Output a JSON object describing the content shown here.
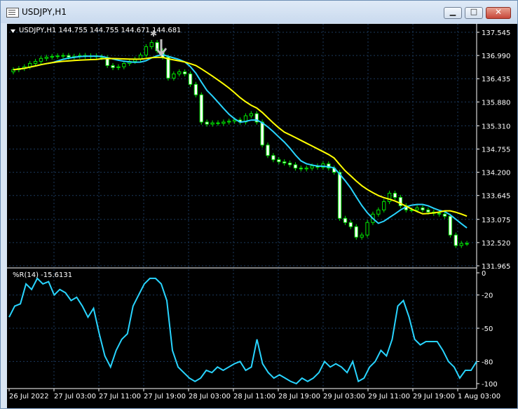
{
  "window": {
    "title": "USDJPY,H1",
    "buttons": {
      "minimize": "▁",
      "maximize": "□",
      "close": "✕"
    }
  },
  "main_panel": {
    "header": "USDJPY,H1  144.755 144.755 144.671 144.681",
    "price_levels": [
      "137.545",
      "136.990",
      "136.435",
      "135.880",
      "135.310",
      "134.755",
      "134.200",
      "133.645",
      "133.075",
      "132.520",
      "131.965"
    ]
  },
  "indicator_panel": {
    "header": "%R(14) -15.6131",
    "levels": [
      "0",
      "-20",
      "-50",
      "-80",
      "-100"
    ]
  },
  "time_labels": [
    "26 Jul 2022",
    "27 Jul 03:00",
    "27 Jul 11:00",
    "27 Jul 19:00",
    "28 Jul 03:00",
    "28 Jul 11:00",
    "28 Jul 19:00",
    "29 Jul 03:00",
    "29 Jul 11:00",
    "29 Jul 19:00",
    "1 Aug 03:00"
  ],
  "colors": {
    "background": "#000000",
    "grid": "#1c3a5e",
    "candle": "#00e600",
    "ma_fast": "#28d4ff",
    "ma_slow": "#ffff00",
    "williams_r": "#28d4ff",
    "text": "#ffffff",
    "arrow": "#c0c0c0"
  },
  "chart_data": {
    "type": "line",
    "panels": [
      {
        "name": "price",
        "series_kinds": [
          "candlestick",
          "line",
          "line"
        ],
        "ylim": [
          131.965,
          137.545
        ],
        "candles_close": [
          136.65,
          136.68,
          136.72,
          136.8,
          136.85,
          136.92,
          136.95,
          136.97,
          136.98,
          136.99,
          136.95,
          136.97,
          136.99,
          136.97,
          136.98,
          136.96,
          136.94,
          136.75,
          136.7,
          136.72,
          136.8,
          136.85,
          136.9,
          137.0,
          137.2,
          137.3,
          137.1,
          136.95,
          136.45,
          136.55,
          136.6,
          136.55,
          136.3,
          136.05,
          135.4,
          135.35,
          135.38,
          135.37,
          135.4,
          135.42,
          135.45,
          135.4,
          135.55,
          135.6,
          135.4,
          134.85,
          134.6,
          134.5,
          134.45,
          134.42,
          134.38,
          134.3,
          134.28,
          134.3,
          134.35,
          134.32,
          134.4,
          134.3,
          134.2,
          133.1,
          133.0,
          132.9,
          132.65,
          132.7,
          133.0,
          133.2,
          133.3,
          133.5,
          133.7,
          133.6,
          133.4,
          133.3,
          133.3,
          133.35,
          133.3,
          133.25,
          133.22,
          133.2,
          133.15,
          132.7,
          132.45,
          132.5,
          132.5
        ],
        "ma_fast_note": "cyan moving average",
        "ma_slow_note": "yellow moving average"
      },
      {
        "name": "williams_r",
        "ylim": [
          -100,
          0
        ],
        "values": [
          -40,
          -30,
          -28,
          -10,
          -15,
          -5,
          -10,
          -8,
          -20,
          -15,
          -18,
          -25,
          -22,
          -30,
          -40,
          -32,
          -55,
          -75,
          -85,
          -70,
          -60,
          -55,
          -30,
          -20,
          -10,
          -5,
          -5,
          -10,
          -25,
          -70,
          -85,
          -90,
          -95,
          -98,
          -95,
          -88,
          -90,
          -85,
          -88,
          -85,
          -82,
          -80,
          -88,
          -85,
          -60,
          -82,
          -90,
          -95,
          -92,
          -95,
          -98,
          -100,
          -95,
          -98,
          -95,
          -90,
          -80,
          -85,
          -82,
          -85,
          -90,
          -80,
          -98,
          -95,
          -85,
          -80,
          -70,
          -75,
          -60,
          -30,
          -25,
          -40,
          -60,
          -65,
          -62,
          -62,
          -62,
          -70,
          -80,
          -85,
          -95,
          -88,
          -88,
          -80
        ]
      }
    ]
  }
}
